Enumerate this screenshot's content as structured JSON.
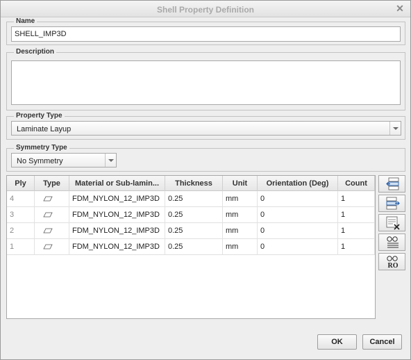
{
  "window": {
    "title": "Shell Property Definition",
    "close_glyph": "✕"
  },
  "name": {
    "label": "Name",
    "value": "SHELL_IMP3D"
  },
  "description": {
    "label": "Description",
    "value": ""
  },
  "property_type": {
    "label": "Property Type",
    "value": "Laminate Layup"
  },
  "symmetry_type": {
    "label": "Symmetry Type",
    "value": "No Symmetry"
  },
  "table": {
    "columns": [
      "Ply",
      "Type",
      "Material or Sub-lamin...",
      "Thickness",
      "Unit",
      "Orientation (Deg)",
      "Count"
    ],
    "rows": [
      {
        "ply": "4",
        "type_icon": "ply-shape-icon",
        "material": "FDM_NYLON_12_IMP3D",
        "thickness": "0.25",
        "unit": "mm",
        "orientation": "0",
        "count": "1"
      },
      {
        "ply": "3",
        "type_icon": "ply-shape-icon",
        "material": "FDM_NYLON_12_IMP3D",
        "thickness": "0.25",
        "unit": "mm",
        "orientation": "0",
        "count": "1"
      },
      {
        "ply": "2",
        "type_icon": "ply-shape-icon",
        "material": "FDM_NYLON_12_IMP3D",
        "thickness": "0.25",
        "unit": "mm",
        "orientation": "0",
        "count": "1"
      },
      {
        "ply": "1",
        "type_icon": "ply-shape-icon",
        "material": "FDM_NYLON_12_IMP3D",
        "thickness": "0.25",
        "unit": "mm",
        "orientation": "0",
        "count": "1"
      }
    ]
  },
  "side_tools": [
    {
      "icon": "insert-ply-before-icon"
    },
    {
      "icon": "insert-ply-after-icon"
    },
    {
      "icon": "delete-ply-icon"
    },
    {
      "icon": "view-layup-icon"
    },
    {
      "icon": "view-ro-icon",
      "text": "RO"
    }
  ],
  "buttons": {
    "ok": "OK",
    "cancel": "Cancel"
  },
  "colors": {
    "dialog_bg": "#eeeeee",
    "title_text": "#a9a9a9"
  }
}
